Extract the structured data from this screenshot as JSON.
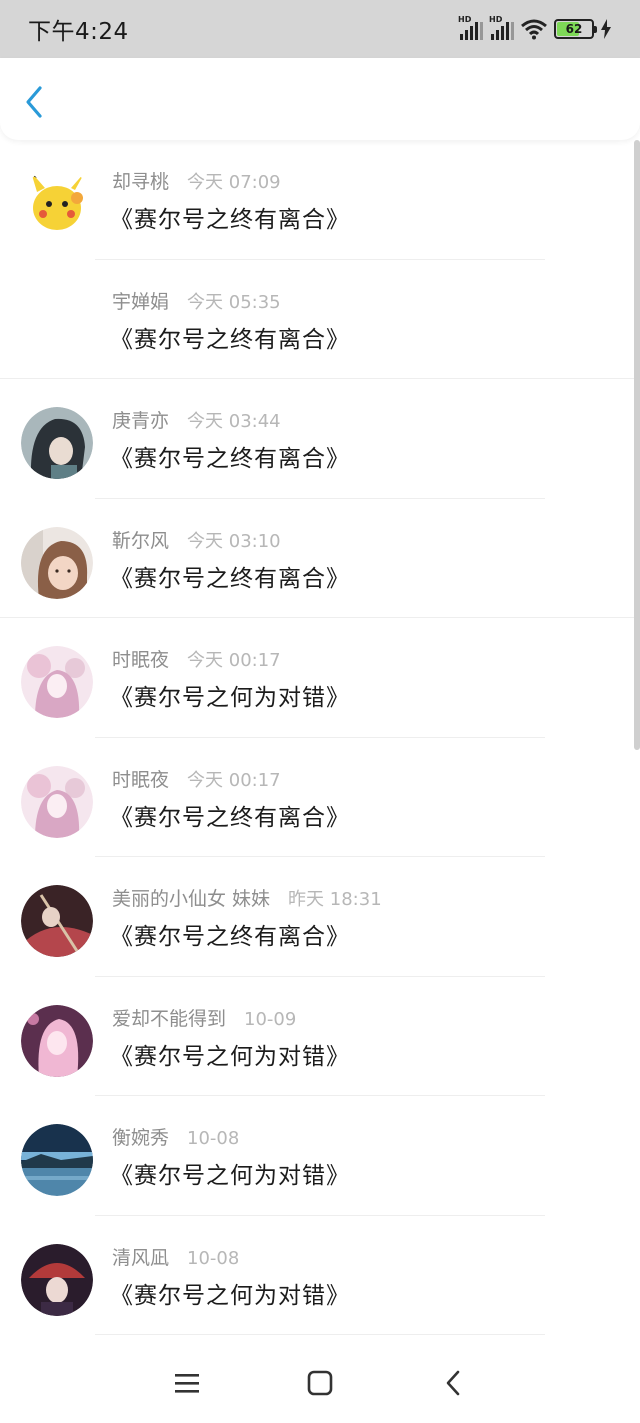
{
  "status_bar": {
    "time": "下午4:24",
    "signal_1_label": "HD",
    "signal_2_label": "HD",
    "battery_level": "62",
    "icons": [
      "signal-icon",
      "signal-icon",
      "wifi-icon",
      "battery-icon",
      "charging-icon"
    ]
  },
  "header": {
    "back_icon": "chevron-left-icon"
  },
  "items": [
    {
      "name": "却寻桃",
      "time": "今天 07:09",
      "title": "《赛尔号之终有离合》",
      "avatar_colors": [
        "#f6d236",
        "#f3a83b"
      ]
    },
    {
      "name": "宇婵娟",
      "time": "今天 05:35",
      "title": "《赛尔号之终有离合》",
      "avatar_colors": []
    },
    {
      "name": "庚青亦",
      "time": "今天 03:44",
      "title": "《赛尔号之终有离合》",
      "avatar_colors": [
        "#3b4a52",
        "#a9b7bb"
      ]
    },
    {
      "name": "靳尔风",
      "time": "今天 03:10",
      "title": "《赛尔号之终有离合》",
      "avatar_colors": [
        "#e8c8b4",
        "#9a7b6a"
      ]
    },
    {
      "name": "时眠夜",
      "time": "今天 00:17",
      "title": "《赛尔号之何为对错》",
      "avatar_colors": [
        "#f2d6e3",
        "#d9a7c4"
      ]
    },
    {
      "name": "时眠夜",
      "time": "今天 00:17",
      "title": "《赛尔号之终有离合》",
      "avatar_colors": [
        "#f2d6e3",
        "#d9a7c4"
      ]
    },
    {
      "name": "美丽的小仙女 妹妹",
      "time": "昨天 18:31",
      "title": "《赛尔号之终有离合》",
      "avatar_colors": [
        "#3a2326",
        "#b4464c"
      ]
    },
    {
      "name": "爱却不能得到",
      "time": "10-09",
      "title": "《赛尔号之何为对错》",
      "avatar_colors": [
        "#5b2f4e",
        "#f0b7d3"
      ]
    },
    {
      "name": "衡婉秀",
      "time": "10-08",
      "title": "《赛尔号之何为对错》",
      "avatar_colors": [
        "#18324d",
        "#78b2d8"
      ]
    },
    {
      "name": "清风凪",
      "time": "10-08",
      "title": "《赛尔号之何为对错》",
      "avatar_colors": [
        "#2a1c2c",
        "#b23a3a"
      ]
    }
  ],
  "nav_bar": {
    "icons": [
      "menu-icon",
      "home-icon",
      "back-icon"
    ]
  },
  "colors": {
    "accent": "#2a9ad8",
    "name_text": "#8e8e8e",
    "time_text": "#b7b7b7",
    "title_text": "#1c1c1c"
  }
}
